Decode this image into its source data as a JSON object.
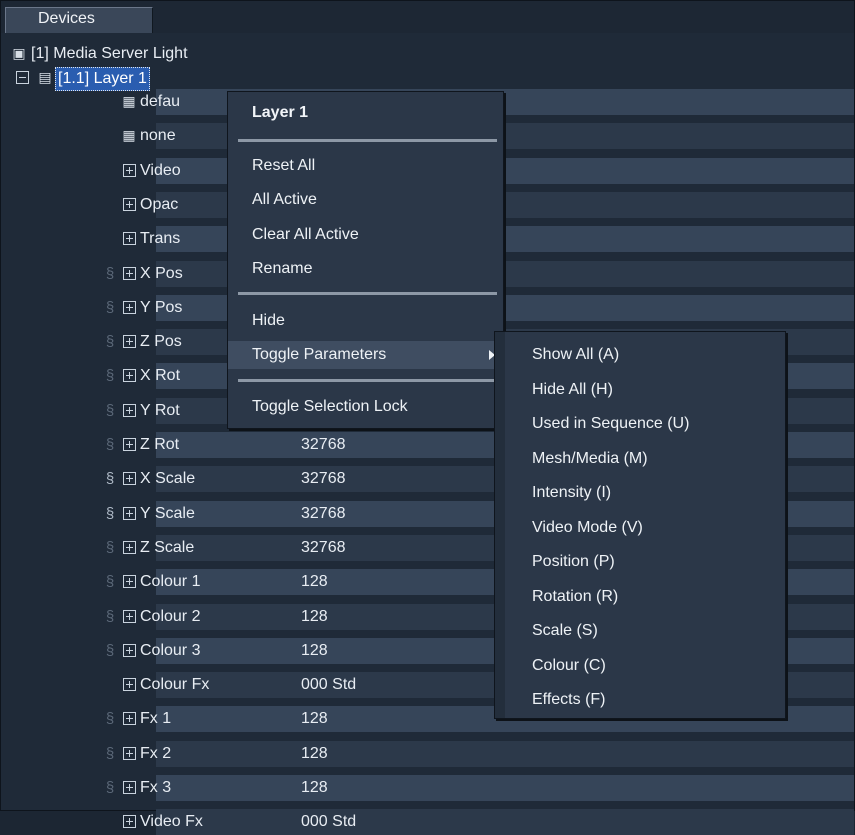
{
  "panel": {
    "tab_label": "Devices"
  },
  "tree": {
    "root": {
      "label": "[1] Media Server Light"
    },
    "layer": {
      "label": "[1.1] Layer 1"
    },
    "params": [
      {
        "label": "defau",
        "value": "",
        "icon": "media-icon",
        "lock": "none"
      },
      {
        "label": "none",
        "value": "",
        "icon": "media-icon",
        "lock": "none"
      },
      {
        "label": "Video",
        "value": "",
        "icon": "param-icon",
        "lock": "none"
      },
      {
        "label": "Opac",
        "value": "",
        "icon": "param-icon",
        "lock": "none"
      },
      {
        "label": "Trans",
        "value": "",
        "icon": "param-icon",
        "lock": "none"
      },
      {
        "label": "X Pos",
        "value": "",
        "icon": "param-icon",
        "lock": "dim"
      },
      {
        "label": "Y Pos",
        "value": "",
        "icon": "param-icon",
        "lock": "dim"
      },
      {
        "label": "Z Pos",
        "value": "",
        "icon": "param-icon",
        "lock": "dim"
      },
      {
        "label": "X Rot",
        "value": "",
        "icon": "param-icon",
        "lock": "dim"
      },
      {
        "label": "Y Rot",
        "value": "",
        "icon": "param-icon",
        "lock": "dim"
      },
      {
        "label": "Z Rot",
        "value": "32768",
        "icon": "param-icon",
        "lock": "dim"
      },
      {
        "label": "X Scale",
        "value": "32768",
        "icon": "param-icon",
        "lock": "on"
      },
      {
        "label": "Y Scale",
        "value": "32768",
        "icon": "param-icon",
        "lock": "on"
      },
      {
        "label": "Z Scale",
        "value": "32768",
        "icon": "param-icon",
        "lock": "dim"
      },
      {
        "label": "Colour 1",
        "value": "128",
        "icon": "param-icon",
        "lock": "dim"
      },
      {
        "label": "Colour 2",
        "value": "128",
        "icon": "param-icon",
        "lock": "dim"
      },
      {
        "label": "Colour 3",
        "value": "128",
        "icon": "param-icon",
        "lock": "dim"
      },
      {
        "label": "Colour Fx",
        "value": "000 Std",
        "icon": "param-icon",
        "lock": "none"
      },
      {
        "label": "Fx 1",
        "value": "128",
        "icon": "param-icon",
        "lock": "dim"
      },
      {
        "label": "Fx 2",
        "value": "128",
        "icon": "param-icon",
        "lock": "dim"
      },
      {
        "label": "Fx 3",
        "value": "128",
        "icon": "param-icon",
        "lock": "dim"
      },
      {
        "label": "Video Fx",
        "value": "000 Std",
        "icon": "param-icon",
        "lock": "none"
      }
    ]
  },
  "context_menu": {
    "title": "Layer 1",
    "group1": [
      "Reset All",
      "All Active",
      "Clear All Active",
      "Rename"
    ],
    "group2": [
      "Hide",
      "Toggle Parameters"
    ],
    "group3": [
      "Toggle Selection Lock"
    ]
  },
  "submenu": {
    "items": [
      "Show All (A)",
      "Hide All (H)",
      "Used in Sequence (U)",
      "Mesh/Media (M)",
      "Intensity (I)",
      "Video Mode (V)",
      "Position (P)",
      "Rotation (R)",
      "Scale (S)",
      "Colour (C)",
      "Effects (F)"
    ]
  },
  "colors": {
    "selection": "#2a5db0",
    "background": "#1f2a38"
  }
}
